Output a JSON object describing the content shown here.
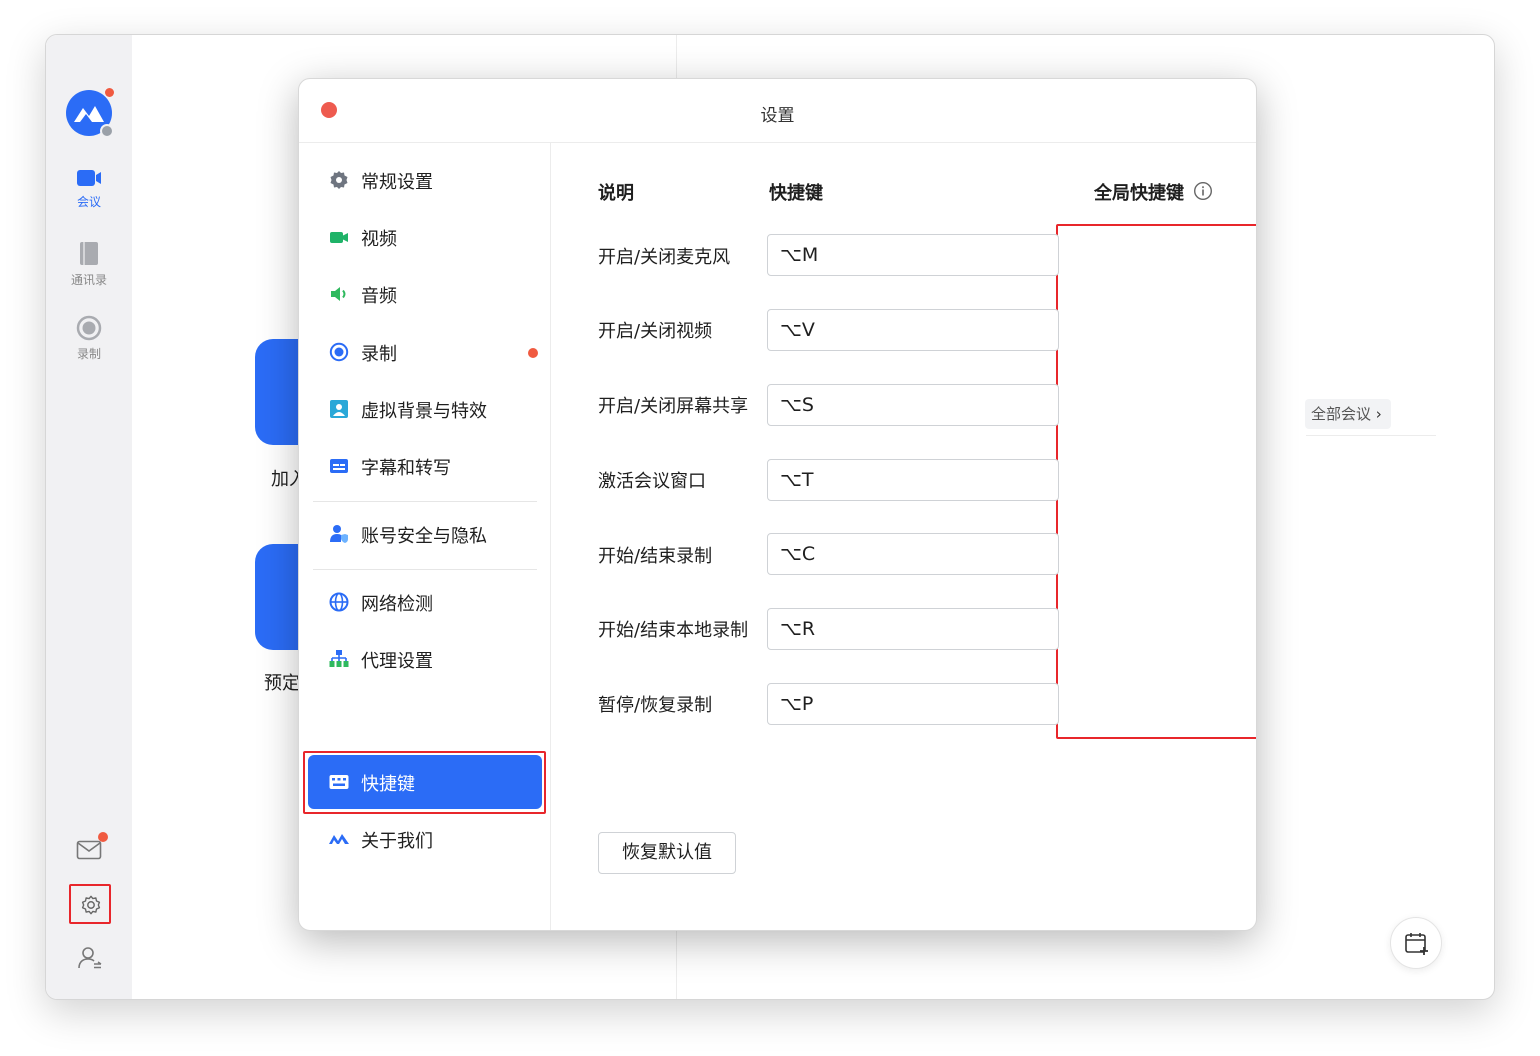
{
  "app": {
    "rail": {
      "meeting_label": "会议",
      "contacts_label": "通讯录",
      "record_label": "录制"
    },
    "background": {
      "join_label": "加入",
      "schedule_label": "预定",
      "all_meetings": "全部会议"
    },
    "accent_color": "#2b6cf6",
    "highlight_color": "#e8262b"
  },
  "dialog": {
    "title": "设置",
    "menu": [
      {
        "label": "常规设置",
        "icon": "gear-icon"
      },
      {
        "label": "视频",
        "icon": "video-icon"
      },
      {
        "label": "音频",
        "icon": "speaker-icon"
      },
      {
        "label": "录制",
        "icon": "record-icon",
        "badge": true
      },
      {
        "label": "虚拟背景与特效",
        "icon": "portrait-icon"
      },
      {
        "label": "字幕和转写",
        "icon": "subtitle-icon"
      },
      {
        "label": "账号安全与隐私",
        "icon": "account-shield-icon"
      },
      {
        "label": "网络检测",
        "icon": "globe-icon"
      },
      {
        "label": "代理设置",
        "icon": "network-tree-icon"
      },
      {
        "label": "快捷键",
        "icon": "keyboard-icon",
        "active": true
      },
      {
        "label": "关于我们",
        "icon": "brand-icon"
      }
    ],
    "shortcuts": {
      "headers": {
        "description": "说明",
        "shortcut": "快捷键",
        "global": "全局快捷键"
      },
      "rows": [
        {
          "label": "开启/关闭麦克风",
          "key": "⌥M",
          "global": false
        },
        {
          "label": "开启/关闭视频",
          "key": "⌥V",
          "global": false
        },
        {
          "label": "开启/关闭屏幕共享",
          "key": "⌥S",
          "global": true
        },
        {
          "label": "激活会议窗口",
          "key": "⌥T",
          "global": false
        },
        {
          "label": "开始/结束录制",
          "key": "⌥C",
          "global": false
        },
        {
          "label": "开始/结束本地录制",
          "key": "⌥R",
          "global": false
        },
        {
          "label": "暂停/恢复录制",
          "key": "⌥P",
          "global": false
        }
      ],
      "reset_button": "恢复默认值"
    }
  }
}
